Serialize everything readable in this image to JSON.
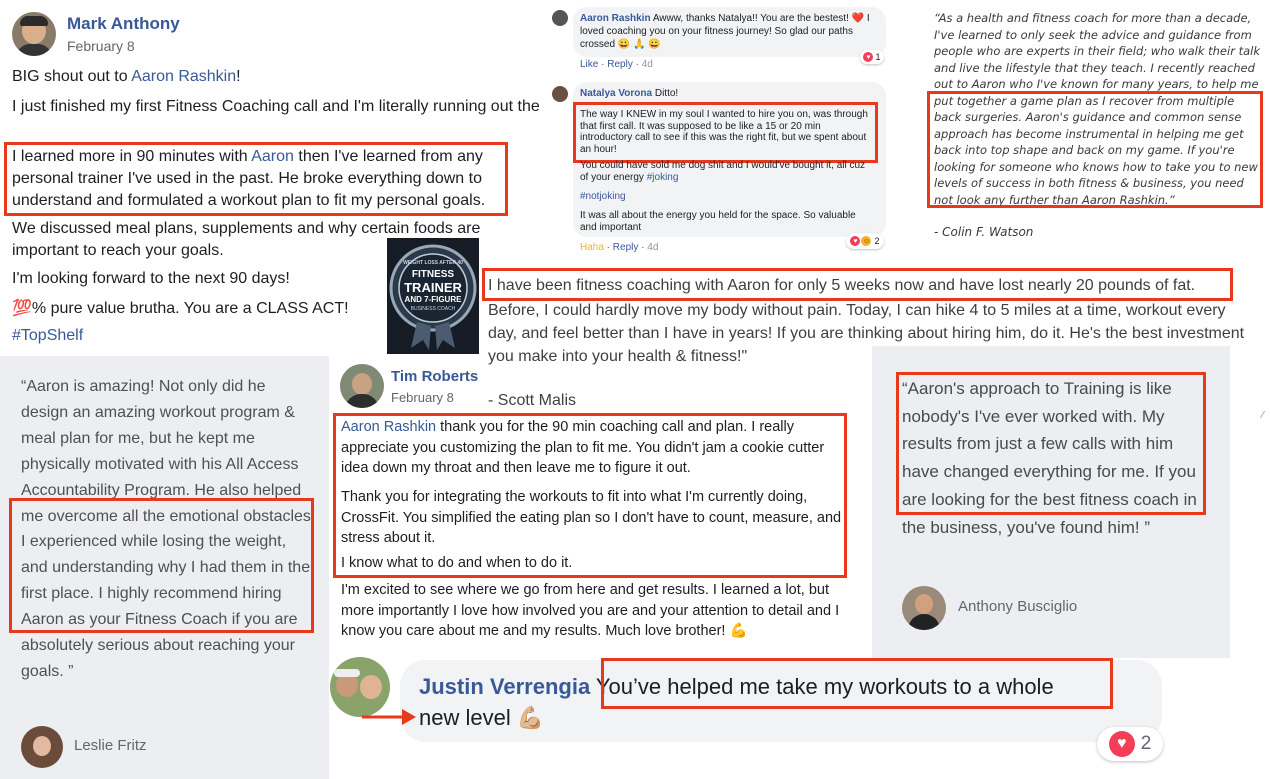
{
  "post1": {
    "author": "Mark Anthony",
    "date": "February 8",
    "line1_prefix": "BIG shout out to ",
    "line1_link": "Aaron Rashkin",
    "line1_suffix": "!",
    "p2": "I just finished my first Fitness Coaching call and I'm literally running out the door to the gym to get started.",
    "p3_prefix": "I learned more in 90 minutes with ",
    "p3_link": "Aaron",
    "p3_suffix": " then I've learned from any personal trainer I've used in the past. He broke everything down to understand and formulated a workout plan to fit my personal goals.",
    "p4": "We discussed meal plans, supplements and why certain foods are important to reach your goals.",
    "p5": "I'm looking forward to the next 90 days!",
    "p6_emoji": "💯",
    "p6": "% pure value brutha. You are a CLASS ACT!",
    "hashtag": "#TopShelf"
  },
  "comment1": {
    "author": "Aaron Rashkin",
    "text": "Awww, thanks Natalya!! You are the bestest! ❤️ I loved coaching you on your fitness journey! So glad our paths crossed 😀 🙏 😀",
    "like": "Like",
    "reply": "Reply",
    "time": "4d",
    "count": "1"
  },
  "comment2": {
    "author": "Natalya Vorona",
    "lead": "Ditto!",
    "p1": "The way I KNEW in my soul I wanted to hire you on, was through that first call. It was supposed to be like a 15 or 20 min introductory call to see if this was the right fit, but we spent about an hour!",
    "p2_prefix": "You could have sold me dog shit and I would've bought it, all cuz of your energy ",
    "p2_tag": "#joking",
    "p3": "#notjoking",
    "p4": "It was all about the energy you held for the space. So valuable and important",
    "haha": "Haha",
    "reply": "Reply",
    "time": "4d",
    "count": "2"
  },
  "quote_watson": {
    "text": "“As a health and fitness coach for more than a decade, I've learned to only seek the advice and guidance from people who are experts in their field; who walk their talk and live the lifestyle that they teach. I recently reached out to Aaron who I've known for many years, to help me put together a game plan as I recover from multiple back surgeries. Aaron's guidance and common sense approach has become instrumental in helping me get back into top shape and back on my game. If you're looking for someone who knows how to take you to new levels of success in both fitness & business, you need not look any further than Aaron Rashkin.”",
    "author": "- Colin F. Watson"
  },
  "badge": {
    "top": "WEIGHT LOSS AFTER 40",
    "line1": "FITNESS",
    "line2": "TRAINER",
    "line3": "AND 7-FIGURE",
    "line4": "BUSINESS COACH"
  },
  "scott": {
    "highlight": "I have been fitness coaching with Aaron for only 5 weeks now and have lost nearly 20 pounds of fat.",
    "rest": "Before, I could hardly move my body without pain. Today, I can hike 4 to 5 miles at a time, workout every day, and feel better than I have in years! If you are thinking about hiring him, do it. He's the best investment you make into your health & fitness!\"",
    "author": "- Scott Malis"
  },
  "leslie": {
    "text": "“Aaron is amazing! Not only did he design an amazing workout program & meal plan for me, but he kept me physically motivated with his All Access Accountability Program. He also helped me overcome all the emotional obstacles I experienced while losing the weight, and understanding why I had them in the first place. I highly recommend hiring Aaron as your Fitness Coach if you are absolutely serious about reaching your goals. ”",
    "author": "Leslie Fritz"
  },
  "tim": {
    "author": "Tim Roberts",
    "date": "February 8",
    "p1_link": "Aaron Rashkin",
    "p1": " thank you for the 90 min coaching call and plan. I really appreciate you customizing the plan to fit me. You didn't jam a cookie cutter idea down my throat and then leave me to figure it out.",
    "p2": "Thank you for integrating the workouts to fit into what I'm currently doing, CrossFit. You simplified the eating plan so I don't have to count, measure, and stress about it.",
    "p3": "I know what to do and when to do it.",
    "p4": "I'm excited to see where we go from here and get results. I learned a lot, but more importantly I love how involved you are and your attention to detail and I know you care about me and my results. Much love brother! 💪"
  },
  "anthony": {
    "text": "“Aaron's approach to Training is like nobody's I've ever worked with. My results from just a few calls with him have changed everything for me. If you are looking for the best fitness coach in the business, you've found him! ”",
    "author": "Anthony Busciglio"
  },
  "justin": {
    "author": "Justin Verrengia",
    "text_highlight": "You’ve helped me take my workouts to a whole",
    "text_rest": "new level 💪🏼",
    "count": "2"
  }
}
